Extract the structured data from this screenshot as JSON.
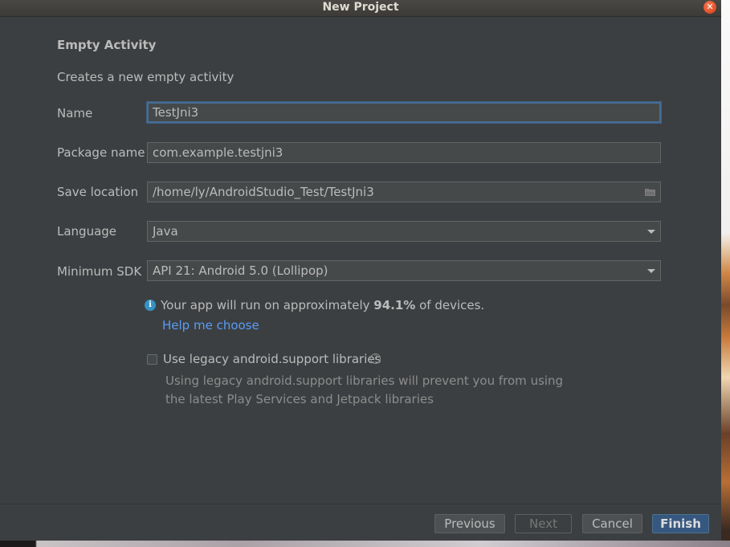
{
  "window": {
    "title": "New Project",
    "close_symbol": "✕"
  },
  "header": {
    "title": "Empty Activity",
    "description": "Creates a new empty activity"
  },
  "form": {
    "name": {
      "label": "Name",
      "value": "TestJni3"
    },
    "package_name": {
      "label": "Package name",
      "value": "com.example.testjni3"
    },
    "save_location": {
      "label": "Save location",
      "value": "/home/ly/AndroidStudio_Test/TestJni3",
      "icon": "folder-icon"
    },
    "language": {
      "label": "Language",
      "value": "Java"
    },
    "minimum_sdk": {
      "label": "Minimum SDK",
      "value": "API 21: Android 5.0 (Lollipop)"
    }
  },
  "info": {
    "icon": "info-icon",
    "text_before": "Your app will run on approximately ",
    "percent": "94.1%",
    "text_after": " of devices.",
    "help_link": "Help me choose"
  },
  "legacy": {
    "checked": false,
    "label": "Use legacy android.support libraries",
    "help_icon": "question-icon",
    "help_symbol": "?",
    "hint_line1": "Using legacy android.support libraries will prevent you from using",
    "hint_line2": "the latest Play Services and Jetpack libraries"
  },
  "buttons": {
    "previous": "Previous",
    "next": "Next",
    "cancel": "Cancel",
    "finish": "Finish"
  },
  "colors": {
    "dialog_bg": "#3c3f41",
    "text": "#bbbbbb",
    "link": "#589df6",
    "focus_border": "#466d94",
    "primary_button": "#365880",
    "close_button": "#e5532d",
    "info_icon": "#3592c4"
  }
}
